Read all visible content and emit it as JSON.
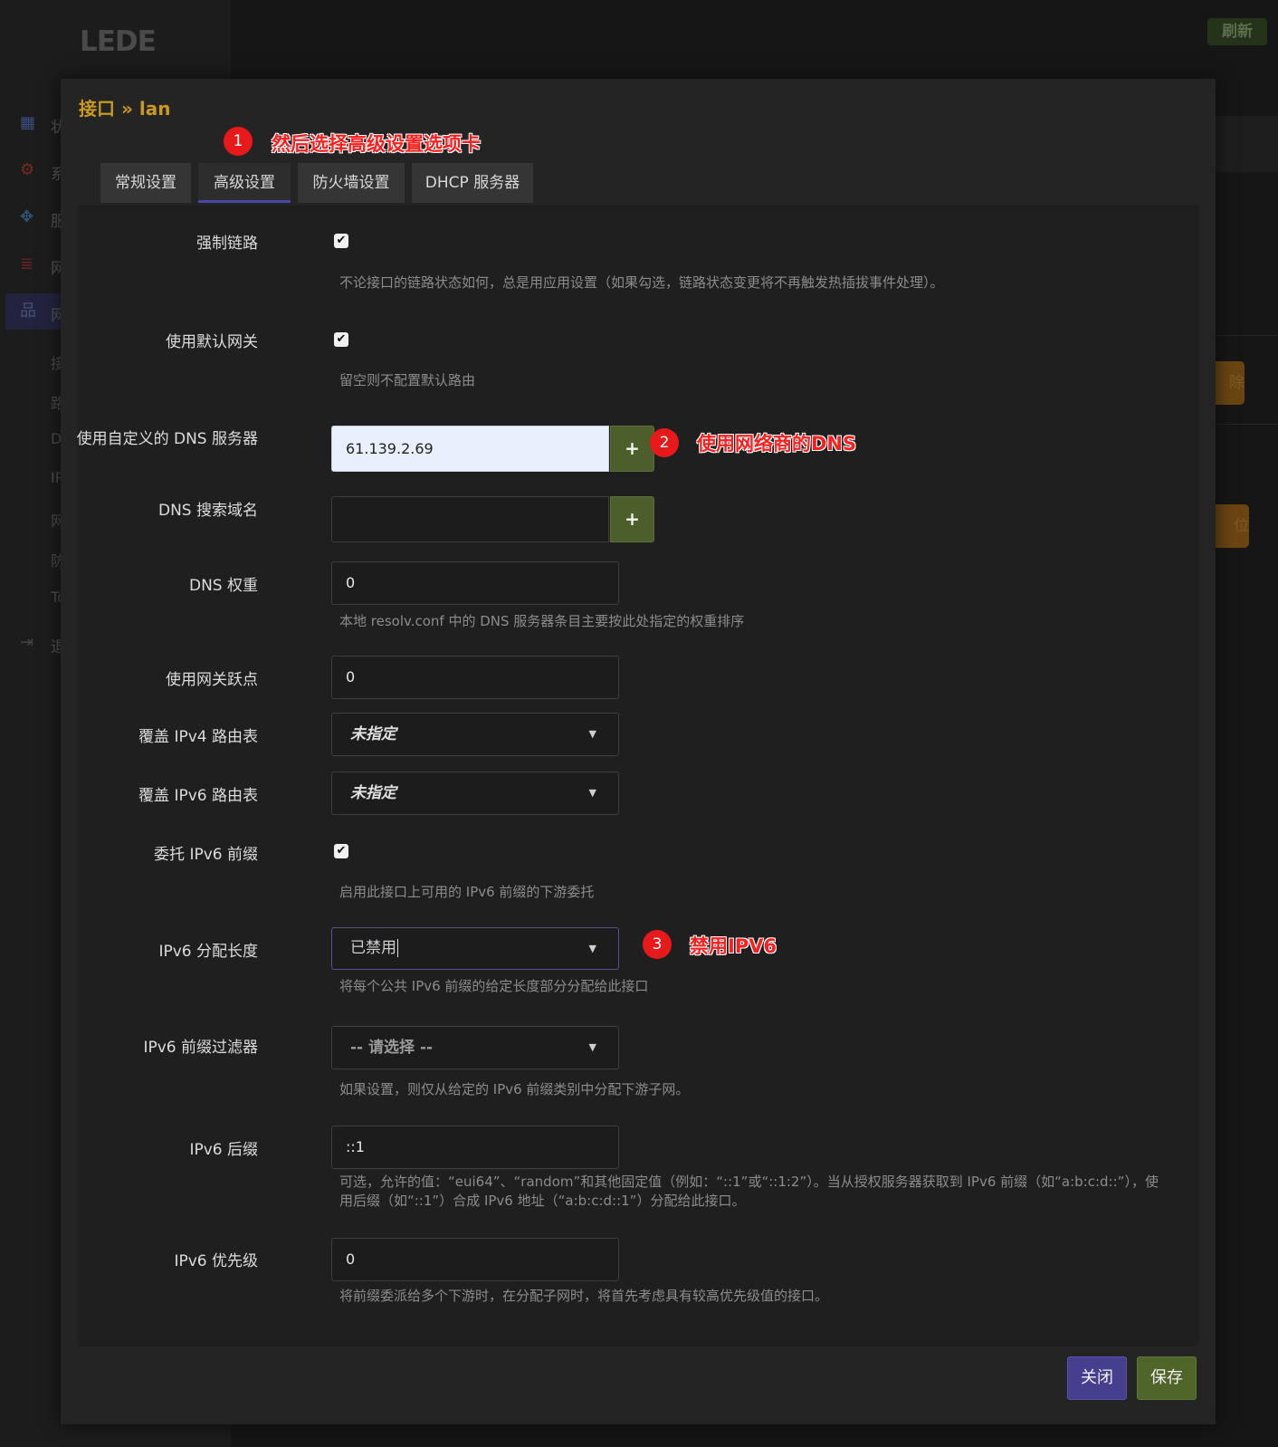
{
  "app": {
    "logo": "LEDE",
    "refresh_label": "刷新",
    "sidebar": [
      {
        "label": "状",
        "icon": "dashboard-icon"
      },
      {
        "label": "系",
        "icon": "gear-icon"
      },
      {
        "label": "服",
        "icon": "puzzle-icon"
      },
      {
        "label": "网",
        "icon": "database-icon"
      },
      {
        "label": "网",
        "icon": "network-icon"
      }
    ],
    "sub_items": [
      "接",
      "路",
      "D",
      "IP",
      "网",
      "防",
      "To"
    ],
    "logout": "退",
    "bg_button_1": "除",
    "bg_button_2": "位"
  },
  "modal": {
    "title": "接口 » lan",
    "tabs": [
      {
        "label": "常规设置"
      },
      {
        "label": "高级设置"
      },
      {
        "label": "防火墙设置"
      },
      {
        "label": "DHCP 服务器"
      }
    ],
    "active_tab": "高级设置",
    "fields": {
      "force_link": {
        "label": "强制链路",
        "checked": true,
        "desc": "不论接口的链路状态如何，总是用应用设置（如果勾选，链路状态变更将不再触发热插拔事件处理）。"
      },
      "default_gw": {
        "label": "使用默认网关",
        "checked": true,
        "desc": "留空则不配置默认路由"
      },
      "custom_dns": {
        "label": "使用自定义的 DNS 服务器",
        "value": "61.139.2.69",
        "add": "+"
      },
      "dns_search": {
        "label": "DNS 搜索域名",
        "value": "",
        "add": "+"
      },
      "dns_weight": {
        "label": "DNS 权重",
        "value": "0",
        "desc": "本地 resolv.conf 中的 DNS 服务器条目主要按此处指定的权重排序"
      },
      "gw_metric": {
        "label": "使用网关跃点",
        "value": "0"
      },
      "ipv4_table": {
        "label": "覆盖 IPv4 路由表",
        "value": "未指定"
      },
      "ipv6_table": {
        "label": "覆盖 IPv6 路由表",
        "value": "未指定"
      },
      "delegate": {
        "label": "委托 IPv6 前缀",
        "checked": true,
        "desc": "启用此接口上可用的 IPv6 前缀的下游委托"
      },
      "ip6assign": {
        "label": "IPv6 分配长度",
        "value": "已禁用",
        "desc": "将每个公共 IPv6 前缀的给定长度部分分配给此接口"
      },
      "ip6filter": {
        "label": "IPv6 前缀过滤器",
        "value": "-- 请选择 --",
        "desc": "如果设置，则仅从给定的 IPv6 前缀类别中分配下游子网。"
      },
      "ip6hint": {
        "label": "IPv6 后缀",
        "value": "::1",
        "desc_1": "可选，允许的值：“eui64”、“random”和其他固定值（例如：“::1”或“::1:2”）。当从授权服务器获取到 IPv6 前缀（如“a:b:c:d::”），使",
        "desc_2": "用后缀（如“::1”）合成 IPv6 地址（“a:b:c:d::1”）分配给此接口。"
      },
      "ip6prio": {
        "label": "IPv6 优先级",
        "value": "0",
        "desc": "将前缀委派给多个下游时，在分配子网时，将首先考虑具有较高优先级值的接口。"
      }
    },
    "close_label": "关闭",
    "save_label": "保存"
  },
  "annotations": [
    {
      "num": "1",
      "text": "然后选择高级设置选项卡"
    },
    {
      "num": "2",
      "text": "使用网络商的DNS"
    },
    {
      "num": "3",
      "text": "禁用IPV6"
    }
  ],
  "colors": {
    "accent_title": "#c99a1c",
    "annotation_red": "#ff1d1d",
    "add_button": "#4c5f2a",
    "close_button": "#463e8e",
    "save_button": "#4f6428"
  }
}
